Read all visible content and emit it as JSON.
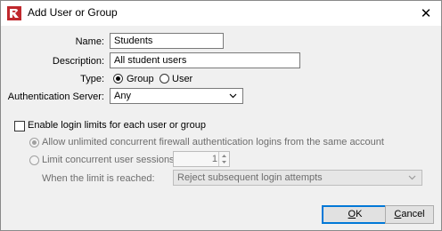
{
  "window": {
    "title": "Add User or Group",
    "close_glyph": "✕"
  },
  "form": {
    "name_label": "Name:",
    "name_value": "Students",
    "description_label": "Description:",
    "description_value": "All student users",
    "type_label": "Type:",
    "type_options": [
      "Group",
      "User"
    ],
    "type_selected": "Group",
    "auth_label": "Authentication Server:",
    "auth_value": "Any"
  },
  "limits": {
    "enable_label": "Enable login limits for each user or group",
    "enable_checked": false,
    "allow_unlimited_label": "Allow unlimited concurrent firewall authentication logins from the same account",
    "limit_sessions_label": "Limit concurrent user sessions to",
    "limit_sessions_value": "1",
    "when_reached_label": "When the limit is reached:",
    "when_reached_value": "Reject subsequent login attempts"
  },
  "buttons": {
    "ok_accel": "O",
    "ok_rest": "K",
    "cancel_accel": "C",
    "cancel_rest": "ancel"
  },
  "colors": {
    "accent": "#0078d7",
    "app_icon_red": "#c0282d"
  },
  "icons": [
    "app-logo-icon",
    "close-icon",
    "chevron-down-icon",
    "spin-up-icon",
    "spin-down-icon"
  ]
}
